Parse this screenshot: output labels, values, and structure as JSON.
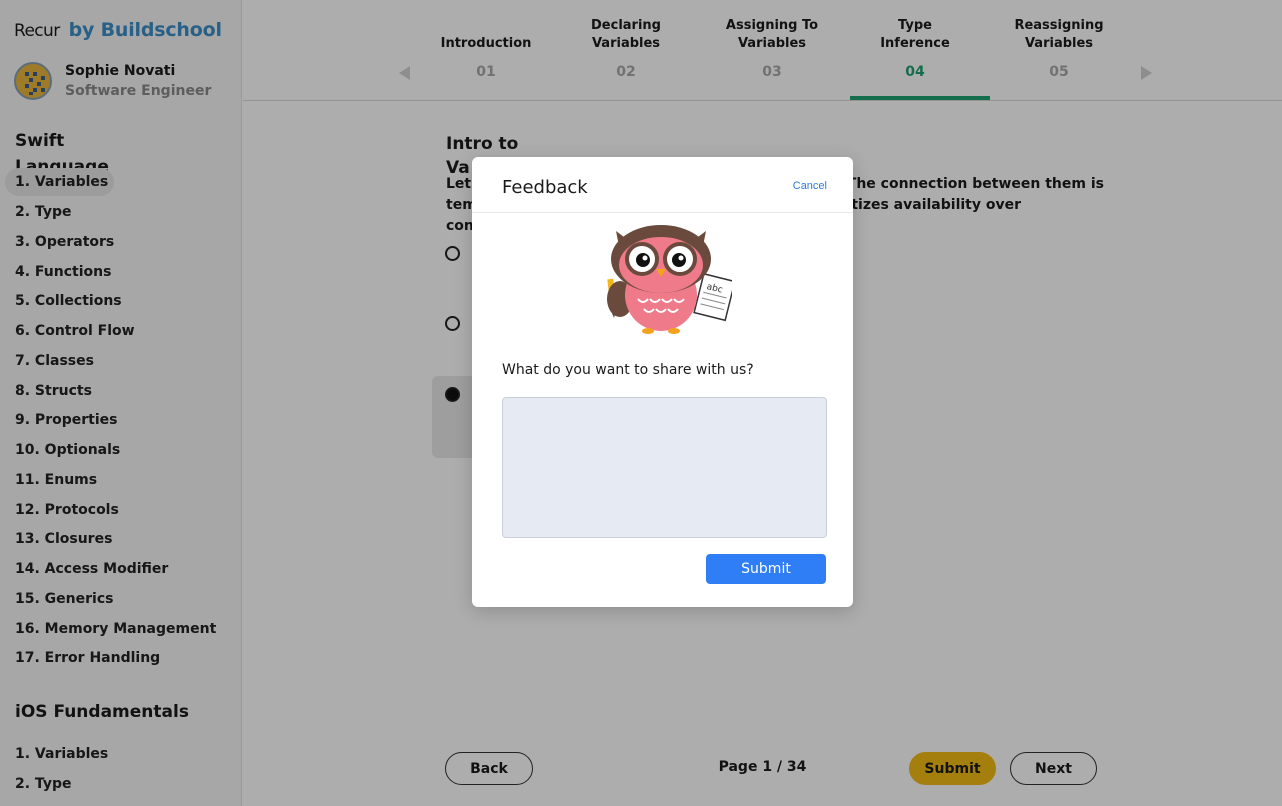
{
  "brand": {
    "name": "Recur",
    "by": "by Buildschool"
  },
  "user": {
    "name": "Sophie Novati",
    "role": "Software Engineer"
  },
  "sidebar": {
    "swift": {
      "title": "Swift Language",
      "items": [
        "1. Variables",
        "2. Type",
        "3. Operators",
        "4. Functions",
        "5. Collections",
        "6. Control Flow",
        "7. Classes",
        "8. Structs",
        "9. Properties",
        "10. Optionals",
        "11. Enums",
        "12. Protocols",
        "13. Closures",
        "14. Access Modifier",
        "15. Generics",
        "16. Memory Management",
        "17. Error Handling"
      ]
    },
    "ios": {
      "title": "iOS Fundamentals",
      "items": [
        "1. Variables",
        "2. Type"
      ]
    }
  },
  "stepper": {
    "steps": [
      {
        "label_line1": "",
        "label_line2": "Introduction",
        "num": "01"
      },
      {
        "label_line1": "Declaring",
        "label_line2": "Variables",
        "num": "02"
      },
      {
        "label_line1": "Assigning To",
        "label_line2": "Variables",
        "num": "03"
      },
      {
        "label_line1": "Type",
        "label_line2": "Inference",
        "num": "04"
      },
      {
        "label_line1": "Reassigning",
        "label_line2": "Variables",
        "num": "05"
      }
    ],
    "active_index": 3
  },
  "question": {
    "title_line1": "Intro to",
    "title_line2": "Va",
    "body_line1": "Let",
    "body_line1_right": "B. The connection between them is",
    "body_line2": "tem",
    "body_line2_right": "oritizes availability over",
    "body_line3": "con"
  },
  "footer": {
    "back": "Back",
    "page": "Page 1 / 34",
    "submit": "Submit",
    "next": "Next"
  },
  "modal": {
    "title": "Feedback",
    "cancel": "Cancel",
    "prompt": "What do you want to share with us?",
    "textarea_value": "",
    "submit": "Submit",
    "illustration_text": "abc"
  },
  "colors": {
    "accent_green": "#1ea372",
    "brand_blue": "#3b8ec8",
    "primary_blue": "#2f7ef6",
    "yellow": "#f2bc16"
  }
}
